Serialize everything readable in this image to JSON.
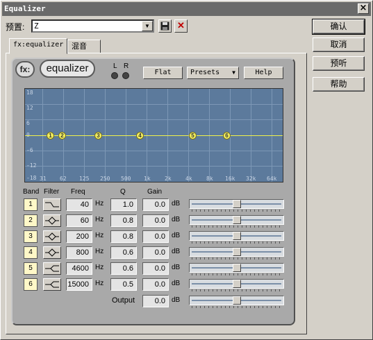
{
  "window": {
    "title": "Equalizer",
    "close": "×"
  },
  "preset": {
    "label": "预置:",
    "value": "Z",
    "drop": "▼",
    "save_icon": "floppy-disk",
    "delete_icon": "red-x",
    "delete_glyph": "✕"
  },
  "buttons": {
    "ok": "确认",
    "cancel": "取消",
    "preview": "预听",
    "help": "帮助"
  },
  "tabs": [
    {
      "label": "fx:equalizer"
    },
    {
      "label": "混音"
    }
  ],
  "plugin": {
    "logo_fx": "fx:",
    "logo_eq": "equalizer",
    "led_l": "L",
    "led_r": "R",
    "flat": "Flat",
    "presets": "Presets",
    "presets_arrow": "▼",
    "help": "Help"
  },
  "graph": {
    "y_ticks": [
      "18",
      "12",
      "6",
      "0",
      "-6",
      "-12",
      "-18"
    ],
    "x_ticks": [
      "31",
      "62",
      "125",
      "250",
      "500",
      "1k",
      "2k",
      "4k",
      "8k",
      "16k",
      "32k",
      "64k"
    ],
    "nodes": [
      "1",
      "2",
      "3",
      "4",
      "5",
      "6"
    ],
    "curve_color": "#f2f24a",
    "bg_color": "#5c7a9c"
  },
  "headers": {
    "band": "Band",
    "filter": "Filter",
    "freq": "Freq",
    "q": "Q",
    "gain": "Gain"
  },
  "bands": [
    {
      "band": "1",
      "filter_icon": "low-shelf-icon",
      "freq": "40",
      "hz": "Hz",
      "q": "1.0",
      "gain": "0.0",
      "db": "dB"
    },
    {
      "band": "2",
      "filter_icon": "peak-icon",
      "freq": "60",
      "hz": "Hz",
      "q": "0.8",
      "gain": "0.0",
      "db": "dB"
    },
    {
      "band": "3",
      "filter_icon": "peak-icon",
      "freq": "200",
      "hz": "Hz",
      "q": "0.8",
      "gain": "0.0",
      "db": "dB"
    },
    {
      "band": "4",
      "filter_icon": "peak-icon",
      "freq": "800",
      "hz": "Hz",
      "q": "0.6",
      "gain": "0.0",
      "db": "dB"
    },
    {
      "band": "5",
      "filter_icon": "high-shelf-icon",
      "freq": "4600",
      "hz": "Hz",
      "q": "0.6",
      "gain": "0.0",
      "db": "dB"
    },
    {
      "band": "6",
      "filter_icon": "high-shelf-icon",
      "freq": "15000",
      "hz": "Hz",
      "q": "0.5",
      "gain": "0.0",
      "db": "dB"
    }
  ],
  "output": {
    "label": "Output",
    "gain": "0.0",
    "db": "dB"
  }
}
